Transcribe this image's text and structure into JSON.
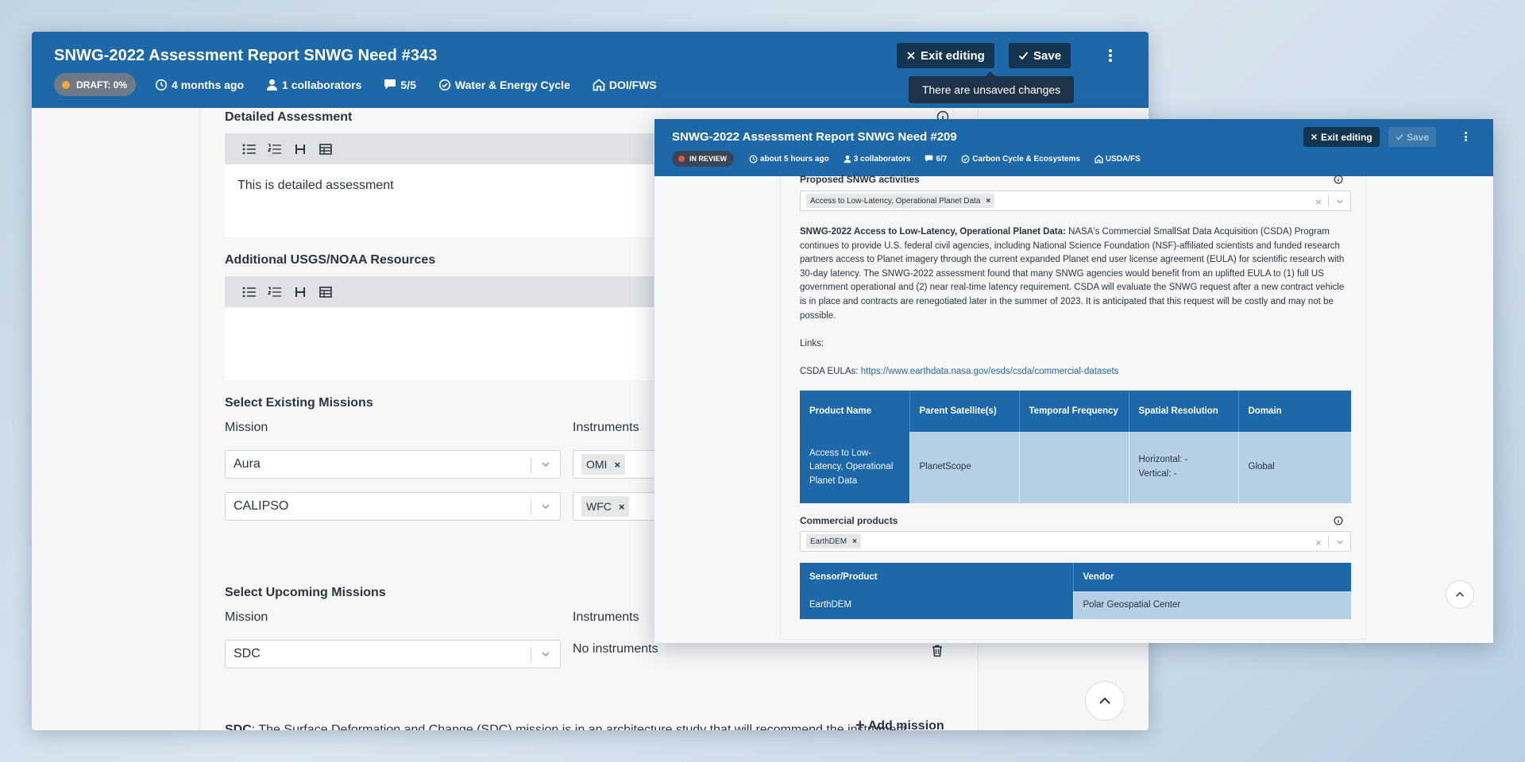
{
  "back": {
    "title": "SNWG-2022 Assessment Report SNWG Need #343",
    "status": "DRAFT: 0%",
    "updated": "4 months ago",
    "collaborators": "1 collaborators",
    "comments": "5/5",
    "topic": "Water & Energy Cycle",
    "agency": "DOI/FWS",
    "exit_label": "Exit editing",
    "save_label": "Save",
    "tooltip": "There are unsaved changes",
    "detailed_label": "Detailed Assessment",
    "detailed_text": "This is detailed assessment",
    "additional_label": "Additional USGS/NOAA Resources",
    "existing_label": "Select Existing Missions",
    "mission_col": "Mission",
    "instruments_col": "Instruments",
    "existing_missions": [
      {
        "mission": "Aura",
        "instrument": "OMI"
      },
      {
        "mission": "CALIPSO",
        "instrument": "WFC"
      }
    ],
    "upcoming_label": "Select Upcoming Missions",
    "upcoming_mission": "SDC",
    "no_instruments": "No instruments",
    "add_mission": "Add mission",
    "sdc_bold": "SDC",
    "sdc_text": ": The Surface Deformation and Change (SDC) mission is in an architecture study that will recommend the instrument"
  },
  "front": {
    "title": "SNWG-2022 Assessment Report SNWG Need #209",
    "status": "IN REVIEW",
    "updated": "about 5 hours ago",
    "collaborators": "3 collaborators",
    "comments": "6/7",
    "topic": "Carbon Cycle & Ecosystems",
    "agency": "USDA/FS",
    "exit_label": "Exit editing",
    "save_label": "Save",
    "proposed_label": "Proposed SNWG activities",
    "proposed_tag": "Access to Low-Latency, Operational Planet Data",
    "para_bold": "SNWG-2022 Access to Low-Latency, Operational Planet Data:",
    "para_text": " NASA's Commercial SmallSat Data Acquisition (CSDA) Program continues to provide U.S. federal civil agencies, including National Science Foundation (NSF)-affiliated scientists and funded research partners access to Planet imagery through the current expanded Planet end user license agreement (EULA) for scientific research with 30-day latency. The SNWG-2022 assessment found that many SNWG agencies would benefit from an uplifted EULA to (1) full US government operational and (2) near real-time latency requirement. CSDA will evaluate the SNWG request after a new contract vehicle is in place and contracts are renegotiated later in the summer of 2023. It is anticipated that this request will be costly and may not be possible.",
    "links_label": "Links:",
    "eula_label": "CSDA EULAs:",
    "eula_url": "https://www.earthdata.nasa.gov/esds/csda/commercial-datasets",
    "product_headers": [
      "Product Name",
      "Parent Satellite(s)",
      "Temporal Frequency",
      "Spatial Resolution",
      "Domain"
    ],
    "product_row": [
      "Access to Low-Latency, Operational Planet Data",
      "PlanetScope",
      "",
      "Horizontal: -\nVertical: -",
      "Global"
    ],
    "commercial_label": "Commercial products",
    "commercial_tag": "EarthDEM",
    "vendor_headers": [
      "Sensor/Product",
      "Vendor"
    ],
    "vendor_row": [
      "EarthDEM",
      "Polar Geospatial Center"
    ]
  },
  "colors": {
    "header_blue": "#1d68a8",
    "button_dark": "#13354f",
    "draft_dot": "#f0a93b",
    "review_dot": "#e0524b"
  }
}
